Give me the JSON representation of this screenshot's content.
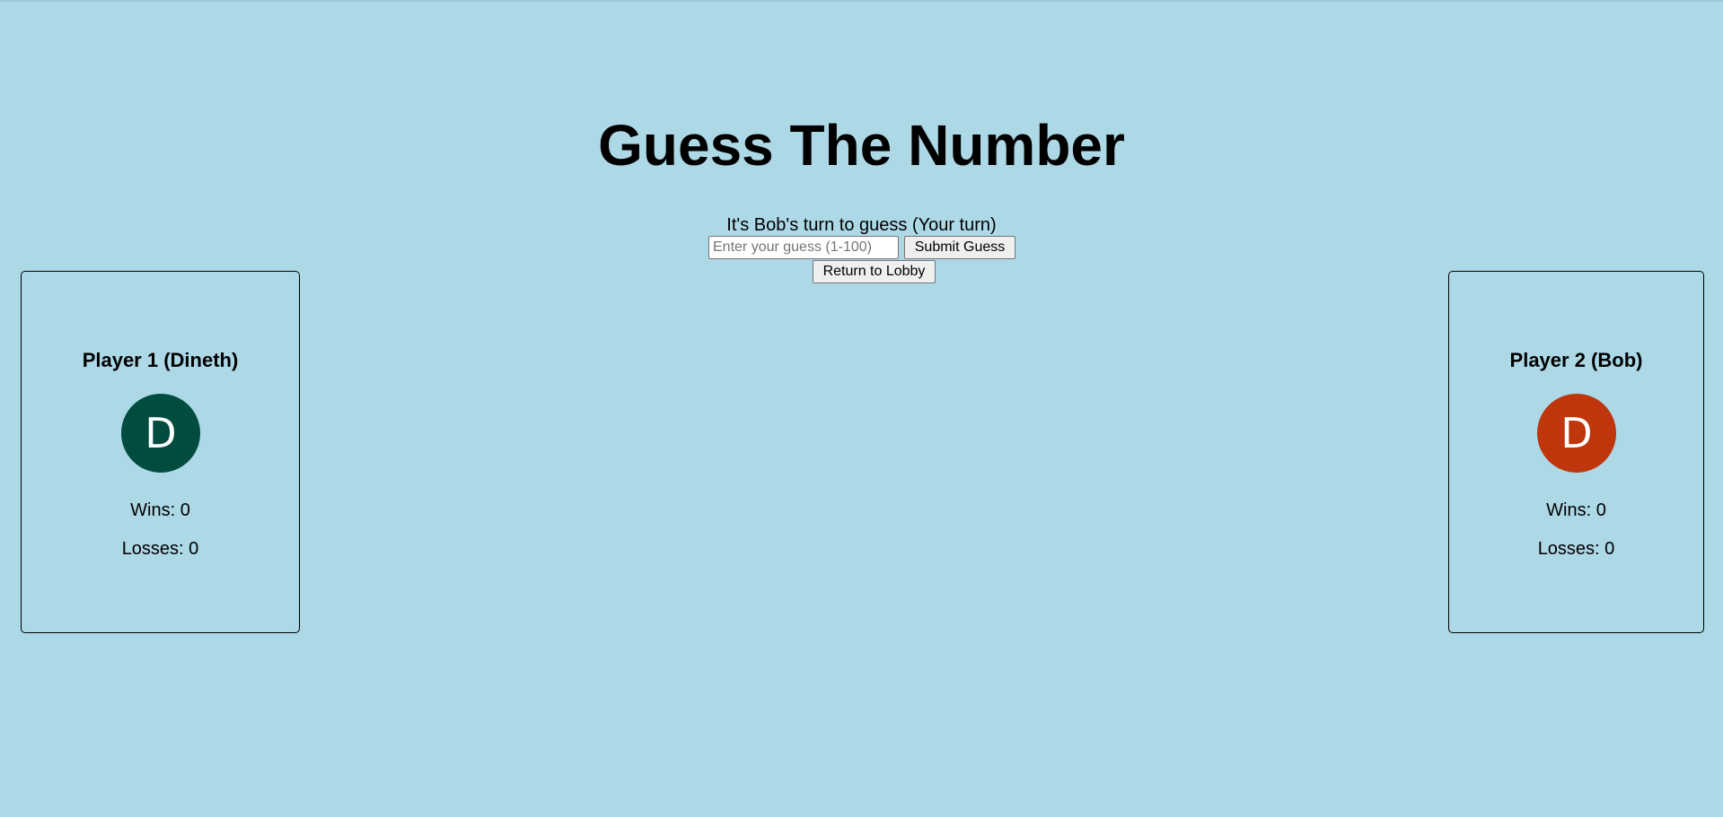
{
  "title": "Guess The Number",
  "turn_message": "It's Bob's turn to guess (Your turn)",
  "guess_input": {
    "placeholder": "Enter your guess (1-100)",
    "value": ""
  },
  "submit_label": "Submit Guess",
  "lobby_label": "Return to Lobby",
  "colors": {
    "background": "#add8e6",
    "player1_avatar": "#004d40",
    "player2_avatar": "#bf360c"
  },
  "players": [
    {
      "name": "Player 1 (Dineth)",
      "initial": "D",
      "wins": "Wins: 0",
      "losses": "Losses: 0"
    },
    {
      "name": "Player 2 (Bob)",
      "initial": "D",
      "wins": "Wins: 0",
      "losses": "Losses: 0"
    }
  ]
}
